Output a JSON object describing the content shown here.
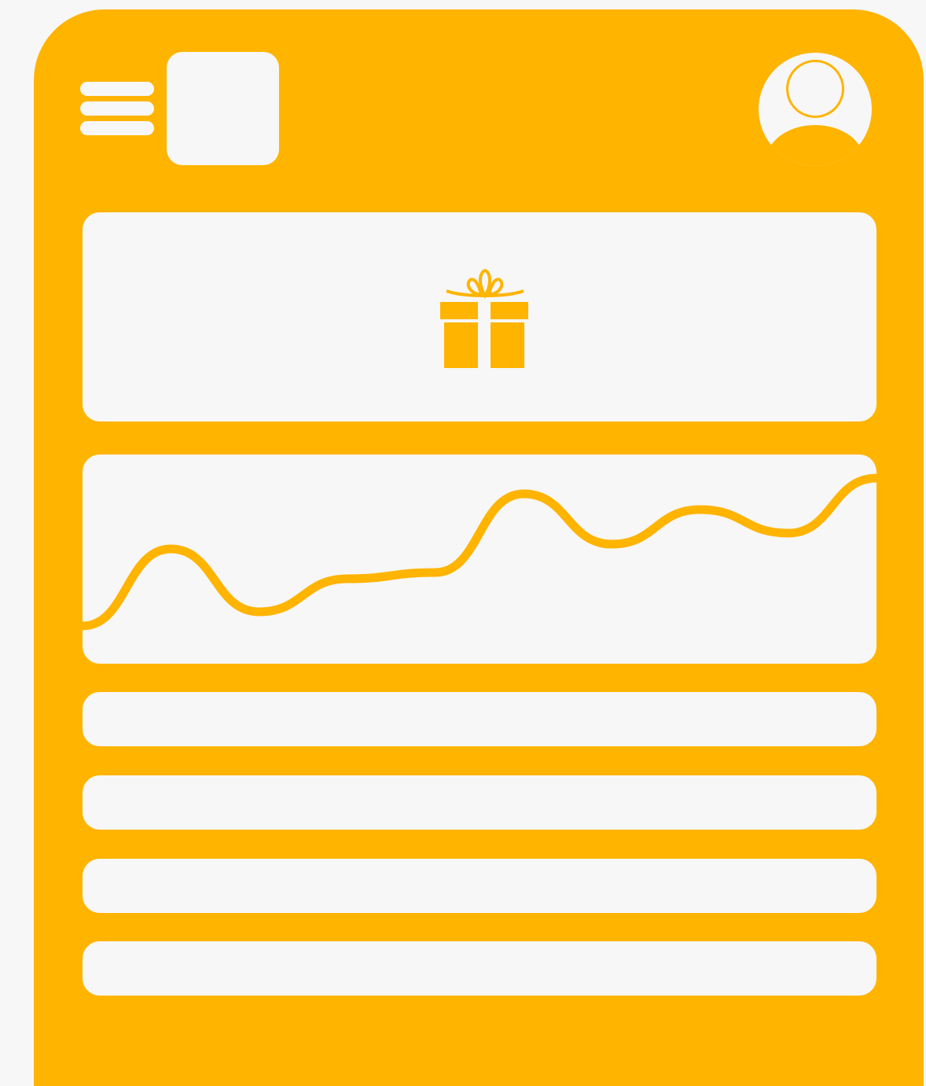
{
  "colors": {
    "accent": "#ffb400",
    "surface": "#f7f7f7"
  },
  "header": {
    "menu_icon": "hamburger-menu-icon",
    "logo": "logo-placeholder",
    "avatar_icon": "user-avatar-icon"
  },
  "banner": {
    "icon": "gift-icon"
  },
  "chart_data": {
    "type": "line",
    "title": "",
    "xlabel": "",
    "ylabel": "",
    "x": [
      0,
      1,
      2,
      3,
      4,
      5,
      6,
      7,
      8,
      9
    ],
    "series": [
      {
        "values": [
          0.06,
          0.55,
          0.15,
          0.36,
          0.4,
          0.9,
          0.58,
          0.8,
          0.65,
          1.0
        ]
      }
    ],
    "ylim": [
      0,
      1
    ],
    "grid": false,
    "line_color": "#ffb400"
  },
  "list": {
    "rows": [
      {
        "label": ""
      },
      {
        "label": ""
      },
      {
        "label": ""
      },
      {
        "label": ""
      }
    ]
  }
}
